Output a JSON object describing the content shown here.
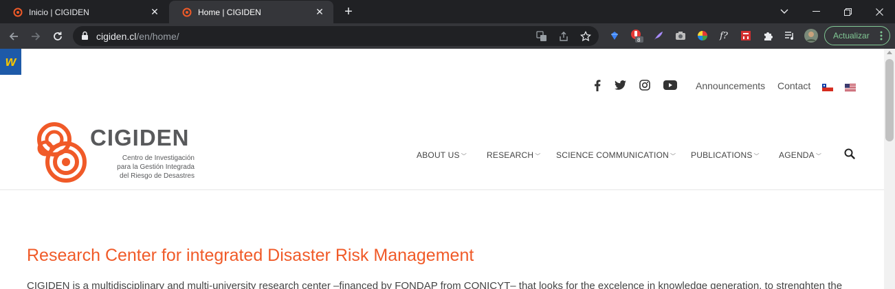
{
  "browser": {
    "tabs": [
      {
        "title": "Inicio | CIGIDEN",
        "active": false
      },
      {
        "title": "Home | CIGIDEN",
        "active": true
      }
    ],
    "url_host": "cigiden.cl",
    "url_path": "/en/home/",
    "extension_badge": "8",
    "update_label": "Actualizar",
    "formula_ext_label": "f?"
  },
  "site": {
    "topbar": {
      "announcements": "Announcements",
      "contact": "Contact"
    },
    "logo": {
      "title": "CIGIDEN",
      "subtitle_line1": "Centro de Investigación",
      "subtitle_line2": "para la Gestión Integrada",
      "subtitle_line3": "del Riesgo de Desastres"
    },
    "nav": [
      {
        "label": "ABOUT US"
      },
      {
        "label": "RESEARCH"
      },
      {
        "label": "SCIENCE COMMUNICATION"
      },
      {
        "label": "PUBLICATIONS"
      },
      {
        "label": "AGENDA"
      }
    ],
    "heading": "Research Center for integrated Disaster Risk Management",
    "intro": "CIGIDEN is a multidisciplinary and multi-university research center –financed by FONDAP from CONICYT– that looks for the excelence in knowledge generation, to strenghten the"
  },
  "colors": {
    "accent": "#f05a28",
    "chrome_dark": "#202124",
    "chrome_toolbar": "#35363a",
    "update_green": "#81c995"
  }
}
